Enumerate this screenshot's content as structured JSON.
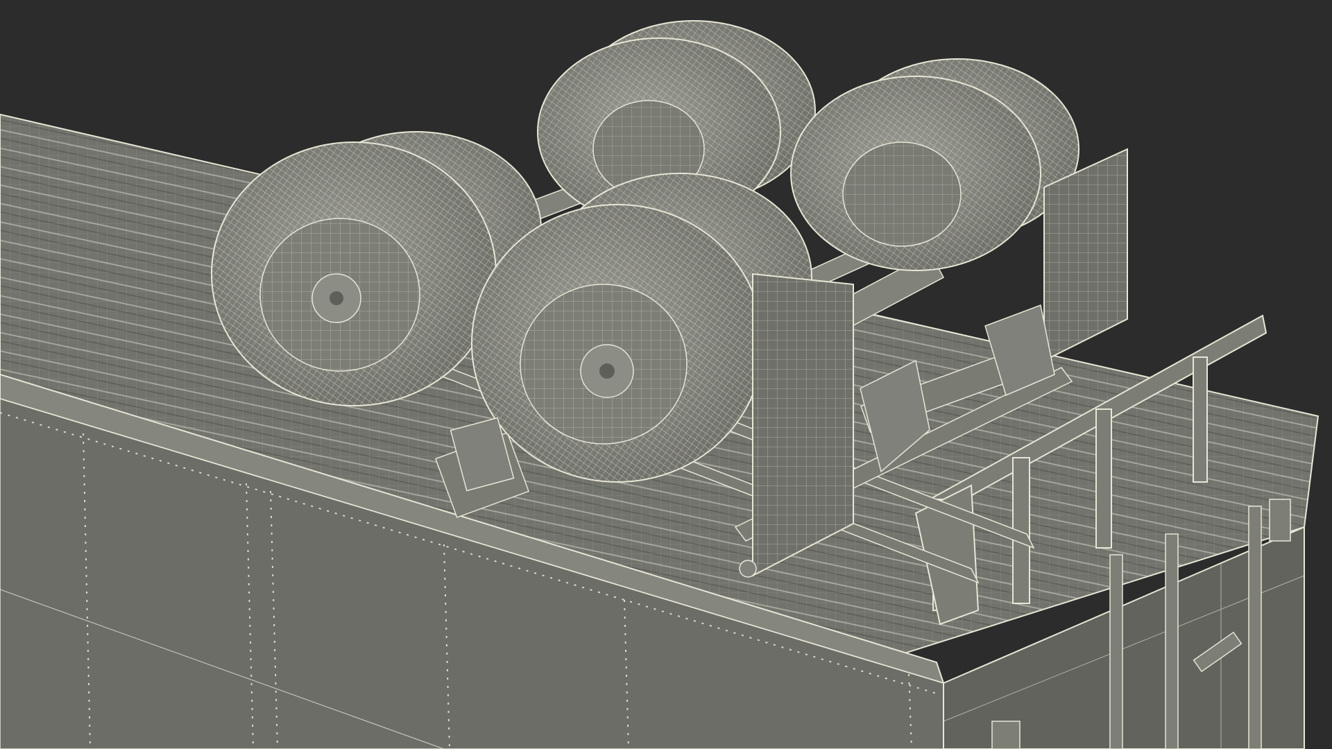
{
  "scene": {
    "subject": "wireframe-render-trailer-underside",
    "colors": {
      "background": "#2b2c2b",
      "body_panel": "#6e6f68",
      "body_panel_dark": "#5e5f59",
      "floor": "#74756e",
      "floor_rib": "#8a8b83",
      "wire": "#e8e6d6",
      "tire": "#8d8e86",
      "tire_wire": "#d9d7c8",
      "metal": "#7a7b73",
      "rivet": "#dcdac9"
    },
    "parts": {
      "wheels": 8,
      "mud_flaps": 2,
      "axles": 2
    }
  }
}
